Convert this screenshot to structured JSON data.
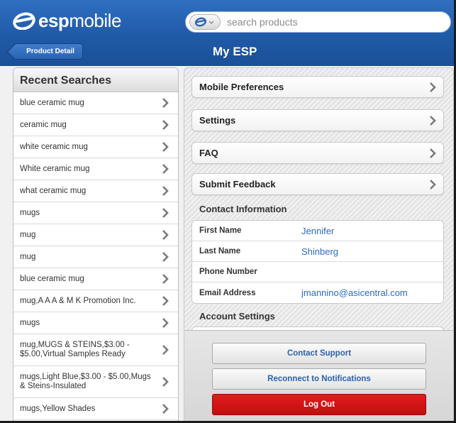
{
  "header": {
    "logo_bold": "esp",
    "logo_light": "mobile",
    "search_placeholder": "search products",
    "back_label": "Product Detail",
    "page_title": "My ESP"
  },
  "recent": {
    "title": "Recent Searches",
    "items": [
      "blue ceramic mug",
      "ceramic mug",
      "white ceramic mug",
      "White ceramic mug",
      "what ceramic mug",
      "mugs",
      "mug",
      "mug",
      "blue ceramic mug",
      "mug,A A A & M K Promotion Inc.",
      "mugs",
      "mug,MUGS & STEINS,$3.00 - $5.00,Virtual Samples Ready",
      "mugs,Light Blue,$3.00 - $5.00,Mugs & Steins-Insulated",
      "mugs,Yellow Shades"
    ]
  },
  "menu": {
    "mobile_preferences": "Mobile Preferences",
    "settings": "Settings",
    "faq": "FAQ",
    "submit_feedback": "Submit Feedback"
  },
  "contact": {
    "title": "Contact Information",
    "first_name_label": "First Name",
    "first_name": "Jennifer",
    "last_name_label": "Last Name",
    "last_name": "Shinberg",
    "phone_label": "Phone Number",
    "phone": "",
    "email_label": "Email Address",
    "email": "jmannino@asicentral.com"
  },
  "account": {
    "title": "Account Settings"
  },
  "actions": {
    "contact_support": "Contact Support",
    "reconnect": "Reconnect to Notifications",
    "logout": "Log Out"
  },
  "colors": {
    "header_blue": "#1f5aa8",
    "link_blue": "#2a6bc4",
    "logout_red": "#d11414"
  }
}
